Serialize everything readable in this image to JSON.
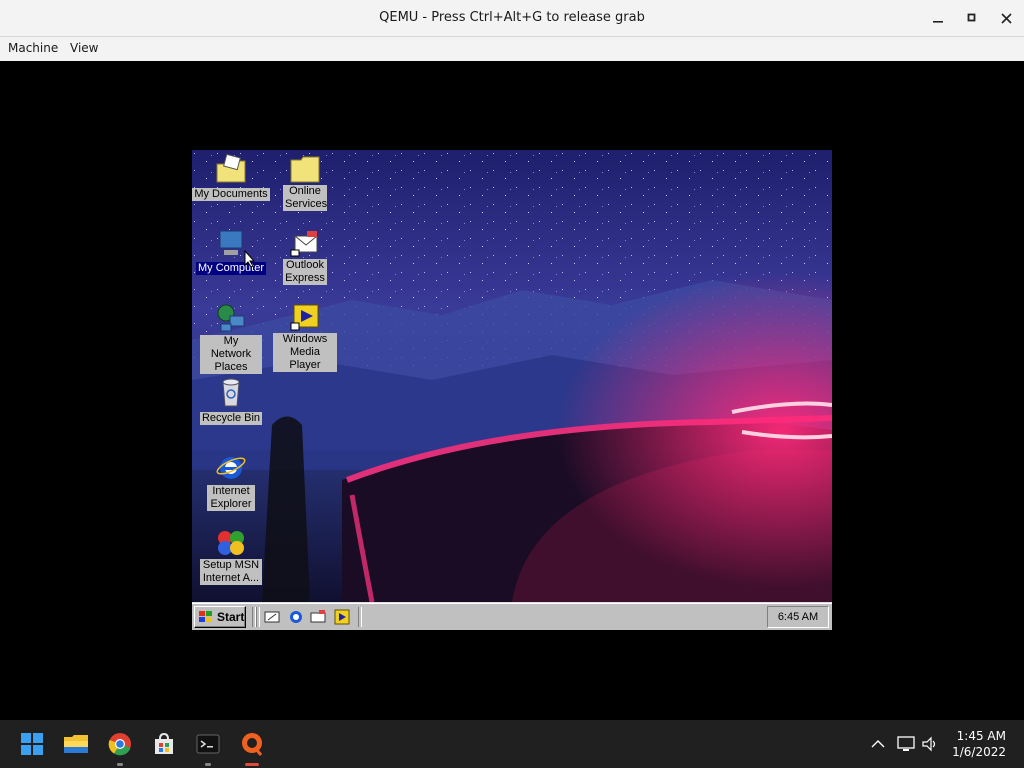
{
  "window": {
    "title": "QEMU - Press Ctrl+Alt+G to release grab",
    "minimize_icon": "minimize-icon",
    "maximize_icon": "maximize-icon",
    "close_icon": "close-icon"
  },
  "menubar": {
    "items": [
      "Machine",
      "View"
    ]
  },
  "guest": {
    "desktop_icons": [
      {
        "label": "My Documents",
        "icon": "folder-documents-icon"
      },
      {
        "label": "Online Services",
        "icon": "folder-icon"
      },
      {
        "label": "My Computer",
        "icon": "computer-icon"
      },
      {
        "label": "Outlook Express",
        "icon": "outlook-express-icon"
      },
      {
        "label": "My Network Places",
        "icon": "network-places-icon"
      },
      {
        "label": "Windows Media Player",
        "icon": "media-player-icon"
      },
      {
        "label": "Recycle Bin",
        "icon": "recycle-bin-icon"
      },
      {
        "label": "Internet Explorer",
        "icon": "internet-explorer-icon"
      },
      {
        "label": "Setup MSN Internet A...",
        "icon": "msn-icon"
      }
    ],
    "taskbar": {
      "start_label": "Start",
      "quick_launch": [
        "show-desktop-icon",
        "internet-explorer-icon",
        "outlook-express-icon",
        "media-player-icon"
      ],
      "clock": "6:45 AM"
    }
  },
  "host_taskbar": {
    "apps": [
      "windows-start-icon",
      "file-explorer-icon",
      "chrome-icon",
      "microsoft-store-icon",
      "terminal-icon",
      "qemu-icon"
    ],
    "tray_icons": [
      "chevron-up-icon",
      "network-icon",
      "volume-icon"
    ],
    "time": "1:45 AM",
    "date": "1/6/2022"
  },
  "colors": {
    "titlebar": "#f3f3f3",
    "guest_taskbar": "#c0c0c0",
    "host_taskbar": "#202020",
    "wallpaper_sky": "#2a2a7a",
    "wallpaper_road_light": "#e0307a"
  }
}
